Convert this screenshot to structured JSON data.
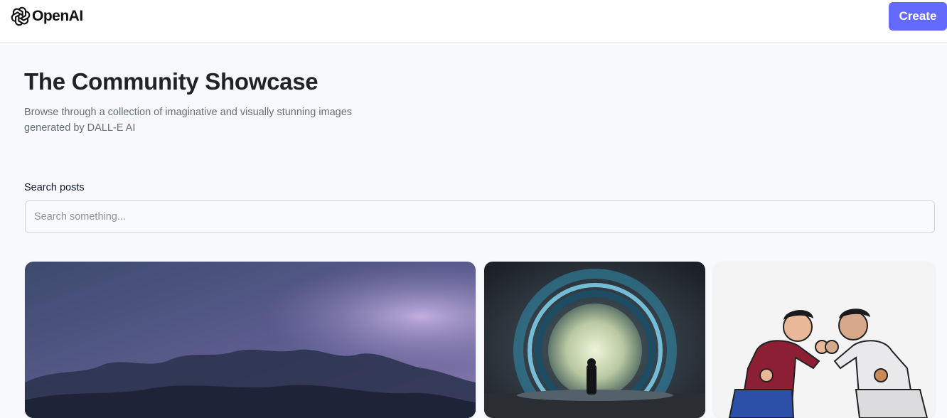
{
  "header": {
    "logo_text": "OpenAI",
    "logo_icon": "openai-logo-icon",
    "create_label": "Create"
  },
  "hero": {
    "title": "The Community Showcase",
    "subtitle": "Browse through a collection of imaginative and visually stunning images generated by DALL-E AI"
  },
  "search": {
    "label": "Search posts",
    "placeholder": "Search something..."
  },
  "colors": {
    "accent": "#6469ff",
    "page_bg": "#f8f9fd",
    "title": "#222328",
    "subtitle": "#666e75"
  },
  "gallery": [
    {
      "subject": "stormy purple sky with dark clouds"
    },
    {
      "subject": "glowing blue portal with silhouetted figure"
    },
    {
      "subject": "two cartoon fighters facing each other"
    }
  ]
}
